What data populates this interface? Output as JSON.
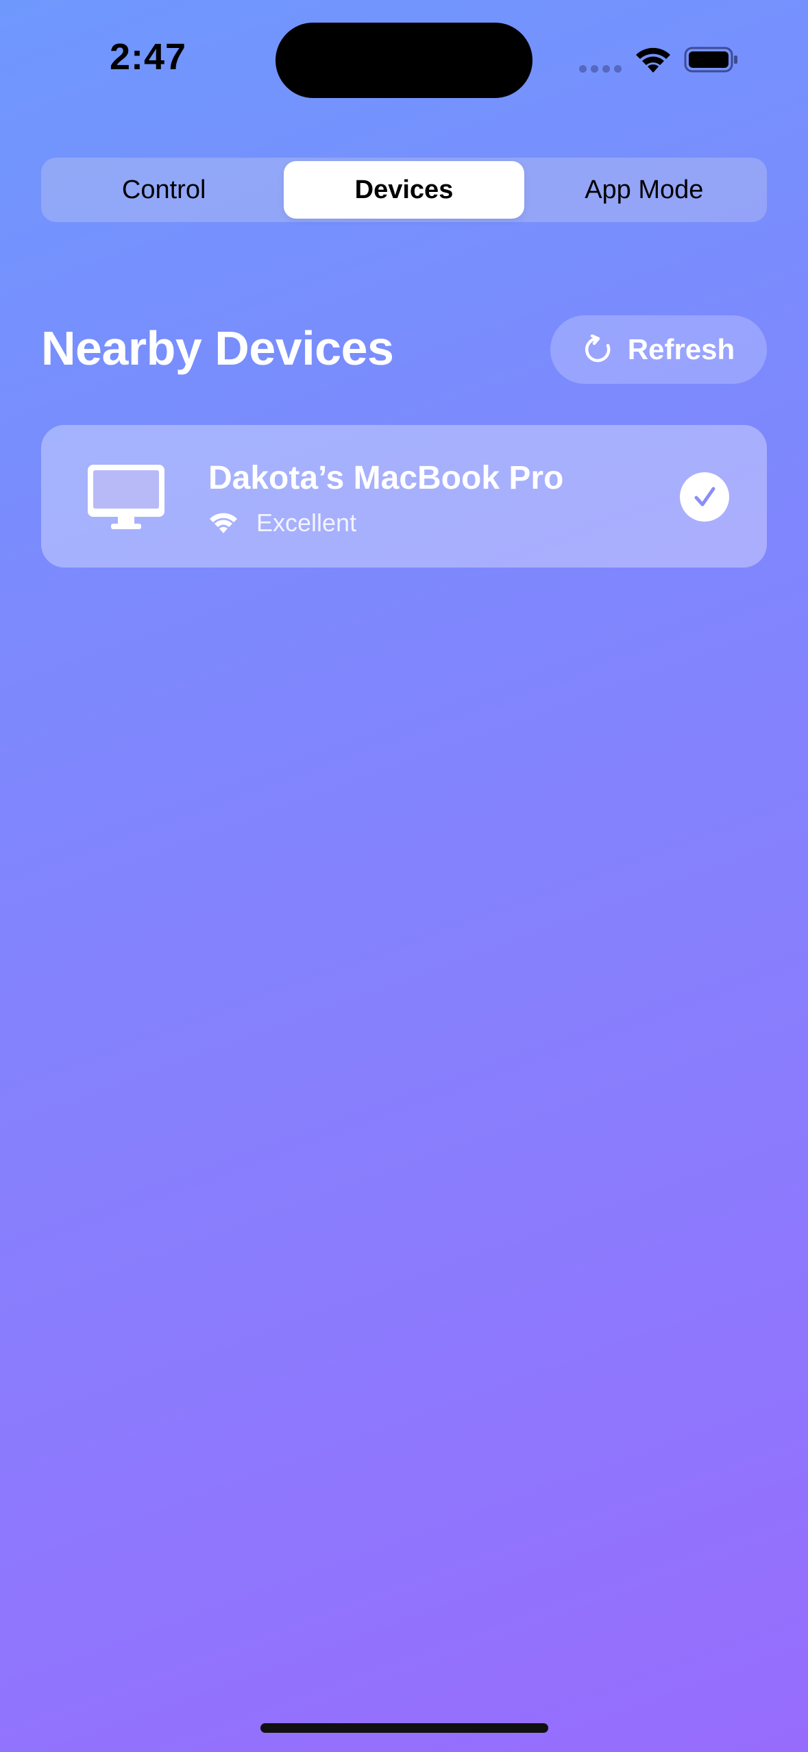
{
  "status_bar": {
    "time": "2:47"
  },
  "segmented_control": {
    "segments": [
      {
        "label": "Control"
      },
      {
        "label": "Devices"
      },
      {
        "label": "App Mode"
      }
    ],
    "selected": "Devices"
  },
  "nearby_devices": {
    "title": "Nearby Devices",
    "refresh_label": "Refresh",
    "devices": [
      {
        "name": "Dakota’s MacBook Pro",
        "signal": "Excellent",
        "icon": "desktop-computer-icon",
        "selected": true
      }
    ]
  },
  "colors": {
    "gradient_top": "#6f98fd",
    "gradient_bottom": "#976cfd",
    "check_accent": "#8a8ef5"
  }
}
